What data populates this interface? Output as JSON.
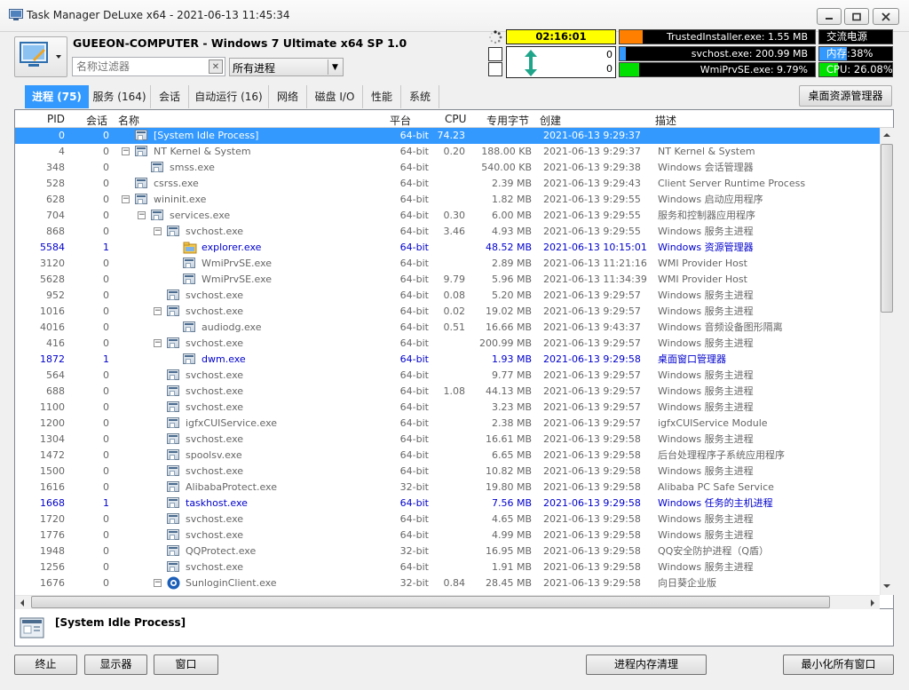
{
  "window": {
    "title": "Task Manager DeLuxe x64 - 2021-06-13 11:45:34"
  },
  "header": {
    "computer_name": "GUEEON-COMPUTER - Windows 7 Ultimate x64 SP 1.0",
    "filter_placeholder": "名称过滤器",
    "process_filter": "所有进程",
    "uptime": "02:16:01",
    "counter_a": "0",
    "counter_b": "0",
    "top_processes": [
      {
        "label": "TrustedInstaller.exe: 1.55 MB",
        "level": 0.12,
        "color": "#ff8000"
      },
      {
        "label": "svchost.exe: 200.99 MB",
        "level": 0.03,
        "color": "#3399ff"
      },
      {
        "label": "WmiPrvSE.exe: 9.79%",
        "level": 0.1,
        "color": "#00e000"
      }
    ],
    "stats": [
      {
        "label": "交流电源",
        "level": 0,
        "color": "#00e000"
      },
      {
        "label": "内存:38%",
        "level": 0.38,
        "color": "#3399ff"
      },
      {
        "label": "CPU: 26.08%",
        "level": 0.26,
        "color": "#00e000"
      }
    ]
  },
  "tabs": [
    {
      "label": "进程 (75)",
      "active": true
    },
    {
      "label": "服务 (164)",
      "active": false
    },
    {
      "label": "会话",
      "active": false
    },
    {
      "label": "自动运行 (16)",
      "active": false
    },
    {
      "label": "网络",
      "active": false
    },
    {
      "label": "磁盘 I/O",
      "active": false
    },
    {
      "label": "性能",
      "active": false
    },
    {
      "label": "系统",
      "active": false
    }
  ],
  "desktop_manager_label": "桌面资源管理器",
  "columns": [
    "PID",
    "会话",
    "名称",
    "平台",
    "CPU",
    "专用字节",
    "创建",
    "描述"
  ],
  "rows": [
    {
      "pid": "0",
      "session": "0",
      "indent": 0,
      "exp": "",
      "name": "[System Idle Process]",
      "platform": "64-bit",
      "cpu": "74.23",
      "bytes": "",
      "created": "2021-06-13 9:29:37",
      "desc": "",
      "icon": "std",
      "sel": true,
      "blue": false
    },
    {
      "pid": "4",
      "session": "0",
      "indent": 0,
      "exp": "−",
      "name": "NT Kernel & System",
      "platform": "64-bit",
      "cpu": "0.20",
      "bytes": "188.00 KB",
      "created": "2021-06-13 9:29:37",
      "desc": "NT Kernel & System",
      "icon": "std",
      "sel": false,
      "blue": false
    },
    {
      "pid": "348",
      "session": "0",
      "indent": 1,
      "exp": "",
      "name": "smss.exe",
      "platform": "64-bit",
      "cpu": "",
      "bytes": "540.00 KB",
      "created": "2021-06-13 9:29:38",
      "desc": "Windows 会话管理器",
      "icon": "std",
      "sel": false,
      "blue": false
    },
    {
      "pid": "528",
      "session": "0",
      "indent": 0,
      "exp": "",
      "name": "csrss.exe",
      "platform": "64-bit",
      "cpu": "",
      "bytes": "2.39 MB",
      "created": "2021-06-13 9:29:43",
      "desc": "Client Server Runtime Process",
      "icon": "std",
      "sel": false,
      "blue": false
    },
    {
      "pid": "628",
      "session": "0",
      "indent": 0,
      "exp": "−",
      "name": "wininit.exe",
      "platform": "64-bit",
      "cpu": "",
      "bytes": "1.82 MB",
      "created": "2021-06-13 9:29:55",
      "desc": "Windows 启动应用程序",
      "icon": "std",
      "sel": false,
      "blue": false
    },
    {
      "pid": "704",
      "session": "0",
      "indent": 1,
      "exp": "−",
      "name": "services.exe",
      "platform": "64-bit",
      "cpu": "0.30",
      "bytes": "6.00 MB",
      "created": "2021-06-13 9:29:55",
      "desc": "服务和控制器应用程序",
      "icon": "std",
      "sel": false,
      "blue": false
    },
    {
      "pid": "868",
      "session": "0",
      "indent": 2,
      "exp": "−",
      "name": "svchost.exe",
      "platform": "64-bit",
      "cpu": "3.46",
      "bytes": "4.93 MB",
      "created": "2021-06-13 9:29:55",
      "desc": "Windows 服务主进程",
      "icon": "std",
      "sel": false,
      "blue": false
    },
    {
      "pid": "5584",
      "session": "1",
      "indent": 3,
      "exp": "",
      "name": "explorer.exe",
      "platform": "64-bit",
      "cpu": "",
      "bytes": "48.52 MB",
      "created": "2021-06-13 10:15:01",
      "desc": "Windows 资源管理器",
      "icon": "folder",
      "sel": false,
      "blue": true
    },
    {
      "pid": "3120",
      "session": "0",
      "indent": 3,
      "exp": "",
      "name": "WmiPrvSE.exe",
      "platform": "64-bit",
      "cpu": "",
      "bytes": "2.89 MB",
      "created": "2021-06-13 11:21:16",
      "desc": "WMI Provider Host",
      "icon": "std",
      "sel": false,
      "blue": false
    },
    {
      "pid": "5628",
      "session": "0",
      "indent": 3,
      "exp": "",
      "name": "WmiPrvSE.exe",
      "platform": "64-bit",
      "cpu": "9.79",
      "bytes": "5.96 MB",
      "created": "2021-06-13 11:34:39",
      "desc": "WMI Provider Host",
      "icon": "std",
      "sel": false,
      "blue": false
    },
    {
      "pid": "952",
      "session": "0",
      "indent": 2,
      "exp": "",
      "name": "svchost.exe",
      "platform": "64-bit",
      "cpu": "0.08",
      "bytes": "5.20 MB",
      "created": "2021-06-13 9:29:57",
      "desc": "Windows 服务主进程",
      "icon": "std",
      "sel": false,
      "blue": false
    },
    {
      "pid": "1016",
      "session": "0",
      "indent": 2,
      "exp": "−",
      "name": "svchost.exe",
      "platform": "64-bit",
      "cpu": "0.02",
      "bytes": "19.02 MB",
      "created": "2021-06-13 9:29:57",
      "desc": "Windows 服务主进程",
      "icon": "std",
      "sel": false,
      "blue": false
    },
    {
      "pid": "4016",
      "session": "0",
      "indent": 3,
      "exp": "",
      "name": "audiodg.exe",
      "platform": "64-bit",
      "cpu": "0.51",
      "bytes": "16.66 MB",
      "created": "2021-06-13 9:43:37",
      "desc": "Windows 音频设备图形隔离",
      "icon": "std",
      "sel": false,
      "blue": false
    },
    {
      "pid": "416",
      "session": "0",
      "indent": 2,
      "exp": "−",
      "name": "svchost.exe",
      "platform": "64-bit",
      "cpu": "",
      "bytes": "200.99 MB",
      "created": "2021-06-13 9:29:57",
      "desc": "Windows 服务主进程",
      "icon": "std",
      "sel": false,
      "blue": false
    },
    {
      "pid": "1872",
      "session": "1",
      "indent": 3,
      "exp": "",
      "name": "dwm.exe",
      "platform": "64-bit",
      "cpu": "",
      "bytes": "1.93 MB",
      "created": "2021-06-13 9:29:58",
      "desc": "桌面窗口管理器",
      "icon": "std",
      "sel": false,
      "blue": true
    },
    {
      "pid": "564",
      "session": "0",
      "indent": 2,
      "exp": "",
      "name": "svchost.exe",
      "platform": "64-bit",
      "cpu": "",
      "bytes": "9.77 MB",
      "created": "2021-06-13 9:29:57",
      "desc": "Windows 服务主进程",
      "icon": "std",
      "sel": false,
      "blue": false
    },
    {
      "pid": "688",
      "session": "0",
      "indent": 2,
      "exp": "",
      "name": "svchost.exe",
      "platform": "64-bit",
      "cpu": "1.08",
      "bytes": "44.13 MB",
      "created": "2021-06-13 9:29:57",
      "desc": "Windows 服务主进程",
      "icon": "std",
      "sel": false,
      "blue": false
    },
    {
      "pid": "1100",
      "session": "0",
      "indent": 2,
      "exp": "",
      "name": "svchost.exe",
      "platform": "64-bit",
      "cpu": "",
      "bytes": "3.23 MB",
      "created": "2021-06-13 9:29:57",
      "desc": "Windows 服务主进程",
      "icon": "std",
      "sel": false,
      "blue": false
    },
    {
      "pid": "1200",
      "session": "0",
      "indent": 2,
      "exp": "",
      "name": "igfxCUIService.exe",
      "platform": "64-bit",
      "cpu": "",
      "bytes": "2.38 MB",
      "created": "2021-06-13 9:29:57",
      "desc": "igfxCUIService Module",
      "icon": "std",
      "sel": false,
      "blue": false
    },
    {
      "pid": "1304",
      "session": "0",
      "indent": 2,
      "exp": "",
      "name": "svchost.exe",
      "platform": "64-bit",
      "cpu": "",
      "bytes": "16.61 MB",
      "created": "2021-06-13 9:29:58",
      "desc": "Windows 服务主进程",
      "icon": "std",
      "sel": false,
      "blue": false
    },
    {
      "pid": "1472",
      "session": "0",
      "indent": 2,
      "exp": "",
      "name": "spoolsv.exe",
      "platform": "64-bit",
      "cpu": "",
      "bytes": "6.65 MB",
      "created": "2021-06-13 9:29:58",
      "desc": "后台处理程序子系统应用程序",
      "icon": "std",
      "sel": false,
      "blue": false
    },
    {
      "pid": "1500",
      "session": "0",
      "indent": 2,
      "exp": "",
      "name": "svchost.exe",
      "platform": "64-bit",
      "cpu": "",
      "bytes": "10.82 MB",
      "created": "2021-06-13 9:29:58",
      "desc": "Windows 服务主进程",
      "icon": "std",
      "sel": false,
      "blue": false
    },
    {
      "pid": "1616",
      "session": "0",
      "indent": 2,
      "exp": "",
      "name": "AlibabaProtect.exe",
      "platform": "32-bit",
      "cpu": "",
      "bytes": "19.80 MB",
      "created": "2021-06-13 9:29:58",
      "desc": "Alibaba PC Safe Service",
      "icon": "std",
      "sel": false,
      "blue": false
    },
    {
      "pid": "1668",
      "session": "1",
      "indent": 2,
      "exp": "",
      "name": "taskhost.exe",
      "platform": "64-bit",
      "cpu": "",
      "bytes": "7.56 MB",
      "created": "2021-06-13 9:29:58",
      "desc": "Windows 任务的主机进程",
      "icon": "std",
      "sel": false,
      "blue": true
    },
    {
      "pid": "1720",
      "session": "0",
      "indent": 2,
      "exp": "",
      "name": "svchost.exe",
      "platform": "64-bit",
      "cpu": "",
      "bytes": "4.65 MB",
      "created": "2021-06-13 9:29:58",
      "desc": "Windows 服务主进程",
      "icon": "std",
      "sel": false,
      "blue": false
    },
    {
      "pid": "1776",
      "session": "0",
      "indent": 2,
      "exp": "",
      "name": "svchost.exe",
      "platform": "64-bit",
      "cpu": "",
      "bytes": "4.99 MB",
      "created": "2021-06-13 9:29:58",
      "desc": "Windows 服务主进程",
      "icon": "std",
      "sel": false,
      "blue": false
    },
    {
      "pid": "1948",
      "session": "0",
      "indent": 2,
      "exp": "",
      "name": "QQProtect.exe",
      "platform": "32-bit",
      "cpu": "",
      "bytes": "16.95 MB",
      "created": "2021-06-13 9:29:58",
      "desc": "QQ安全防护进程（Q盾）",
      "icon": "std",
      "sel": false,
      "blue": false
    },
    {
      "pid": "1256",
      "session": "0",
      "indent": 2,
      "exp": "",
      "name": "svchost.exe",
      "platform": "64-bit",
      "cpu": "",
      "bytes": "1.91 MB",
      "created": "2021-06-13 9:29:58",
      "desc": "Windows 服务主进程",
      "icon": "std",
      "sel": false,
      "blue": false
    },
    {
      "pid": "1676",
      "session": "0",
      "indent": 2,
      "exp": "−",
      "name": "SunloginClient.exe",
      "platform": "32-bit",
      "cpu": "0.84",
      "bytes": "28.45 MB",
      "created": "2021-06-13 9:29:58",
      "desc": "向日葵企业版",
      "icon": "sun",
      "sel": false,
      "blue": false
    }
  ],
  "status": {
    "selected_process": "[System Idle Process]"
  },
  "buttons": {
    "end": "终止",
    "monitor": "显示器",
    "window": "窗口",
    "clean_memory": "进程内存清理",
    "minimize_all": "最小化所有窗口"
  }
}
